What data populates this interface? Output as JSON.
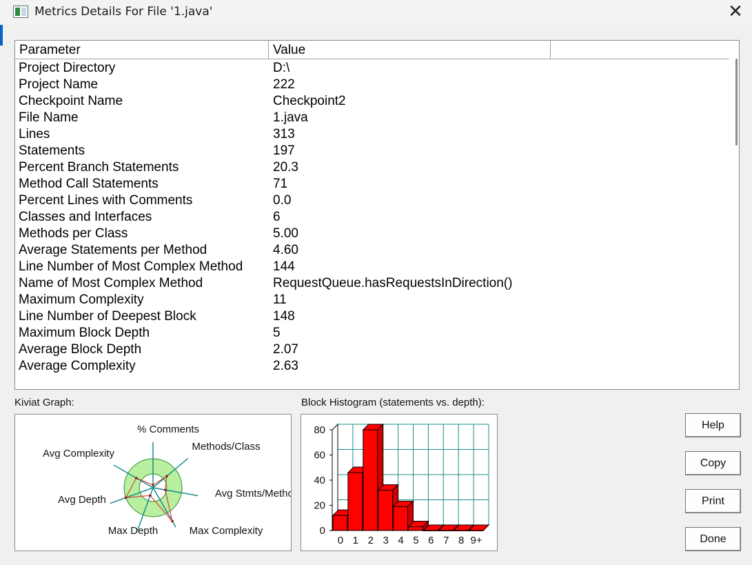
{
  "window": {
    "title": "Metrics Details For File '1.java'",
    "close_glyph": "✕"
  },
  "table": {
    "columns": [
      "Parameter",
      "Value",
      ""
    ],
    "rows": [
      {
        "parameter": "Project Directory",
        "value": "D:\\"
      },
      {
        "parameter": "Project Name",
        "value": "222"
      },
      {
        "parameter": "Checkpoint Name",
        "value": "Checkpoint2"
      },
      {
        "parameter": "File Name",
        "value": "1.java"
      },
      {
        "parameter": "Lines",
        "value": "313"
      },
      {
        "parameter": "Statements",
        "value": "197"
      },
      {
        "parameter": "Percent Branch Statements",
        "value": "20.3"
      },
      {
        "parameter": "Method Call Statements",
        "value": "71"
      },
      {
        "parameter": "Percent Lines with Comments",
        "value": "0.0"
      },
      {
        "parameter": "Classes and Interfaces",
        "value": "6"
      },
      {
        "parameter": "Methods per Class",
        "value": "5.00"
      },
      {
        "parameter": "Average Statements per Method",
        "value": "4.60"
      },
      {
        "parameter": "Line Number of Most Complex Method",
        "value": "144"
      },
      {
        "parameter": "Name of Most Complex Method",
        "value": "RequestQueue.hasRequestsInDirection()"
      },
      {
        "parameter": "Maximum Complexity",
        "value": "11"
      },
      {
        "parameter": "Line Number of Deepest Block",
        "value": "148"
      },
      {
        "parameter": "Maximum Block Depth",
        "value": "5"
      },
      {
        "parameter": "Average Block Depth",
        "value": "2.07"
      },
      {
        "parameter": "Average Complexity",
        "value": "2.63"
      }
    ]
  },
  "kiviat": {
    "section_label": "Kiviat Graph:",
    "axes": [
      {
        "label": "% Comments"
      },
      {
        "label": "Methods/Class"
      },
      {
        "label": "Avg Stmts/Method"
      },
      {
        "label": "Max Complexity"
      },
      {
        "label": "Max Depth"
      },
      {
        "label": "Avg Depth"
      },
      {
        "label": "Avg Complexity"
      }
    ],
    "colors": {
      "band": "#b8f0a0",
      "axis": "#1a8c8c",
      "polygon": "#e02020",
      "point": "#8b1a1a"
    }
  },
  "histogram": {
    "section_label": "Block Histogram (statements vs. depth):",
    "colors": {
      "bar": "#ff0000",
      "grid": "#1a8c8c"
    }
  },
  "chart_data": {
    "type": "bar",
    "categories": [
      "0",
      "1",
      "2",
      "3",
      "4",
      "5",
      "6",
      "7",
      "8",
      "9+"
    ],
    "values": [
      12,
      46,
      80,
      32,
      19,
      3,
      0,
      0,
      0,
      0
    ],
    "yticks": [
      0,
      20,
      40,
      60,
      80
    ],
    "ylim": [
      0,
      80
    ],
    "grid": true
  },
  "buttons": {
    "help": "Help",
    "copy": "Copy",
    "print": "Print",
    "done": "Done"
  }
}
